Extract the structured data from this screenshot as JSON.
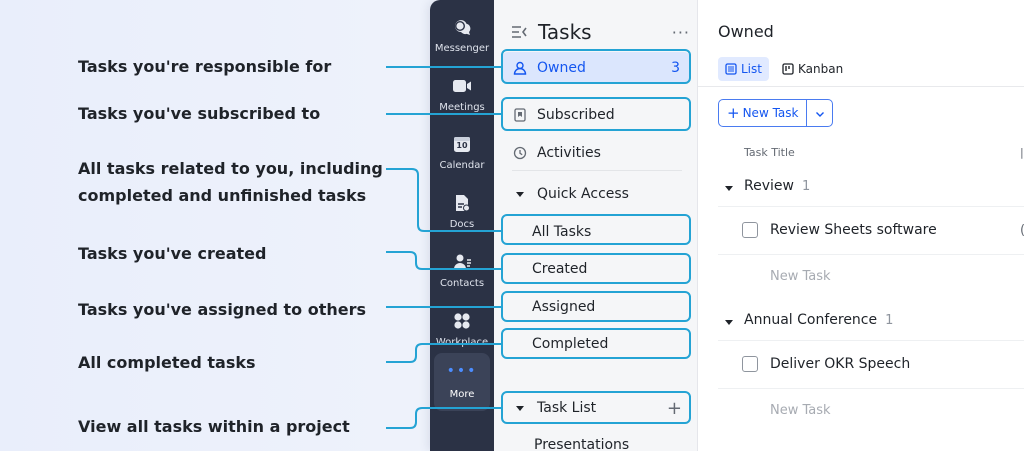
{
  "annotations": {
    "owned": "Tasks you're responsible for",
    "subscribed": "Tasks you've subscribed to",
    "all_line1": "All tasks related to you, including",
    "all_line2": "completed and unfinished tasks",
    "created": "Tasks you've created",
    "assigned": "Tasks you've assigned to others",
    "completed": "All completed tasks",
    "task_list": "View all tasks within a project"
  },
  "rail": {
    "items": [
      {
        "label": "Messenger",
        "icon": "chat-bubbles-icon"
      },
      {
        "label": "Meetings",
        "icon": "video-camera-icon"
      },
      {
        "label": "Calendar",
        "icon": "calendar-icon",
        "day": "10"
      },
      {
        "label": "Docs",
        "icon": "document-icon"
      },
      {
        "label": "Contacts",
        "icon": "contacts-icon"
      },
      {
        "label": "Workplace",
        "icon": "workplace-grid-icon"
      }
    ],
    "more_label": "More"
  },
  "sidebar": {
    "title": "Tasks",
    "more": "···",
    "owned": {
      "label": "Owned",
      "count": "3"
    },
    "subscribed": "Subscribed",
    "activities": "Activities",
    "quick_access": "Quick Access",
    "all_tasks": "All Tasks",
    "created": "Created",
    "assigned": "Assigned",
    "completed": "Completed",
    "task_list": "Task List",
    "presentations": "Presentations"
  },
  "main": {
    "title": "Owned",
    "tabs": [
      {
        "label": "List"
      },
      {
        "label": "Kanban"
      }
    ],
    "new_task_button": "New Task",
    "column_header": "Task Title",
    "groups": [
      {
        "name": "Review",
        "count": "1",
        "task": "Review Sheets software",
        "new_task": "New Task"
      },
      {
        "name": "Annual Conference",
        "count": "1",
        "task": "Deliver OKR Speech",
        "new_task": "New Task"
      }
    ]
  },
  "colors": {
    "accent": "#1456f0",
    "highlight": "#24a3d4",
    "rail_bg": "#2b3245",
    "sidebar_bg": "#f5f6f8",
    "active_bg": "#dbe6fd"
  }
}
